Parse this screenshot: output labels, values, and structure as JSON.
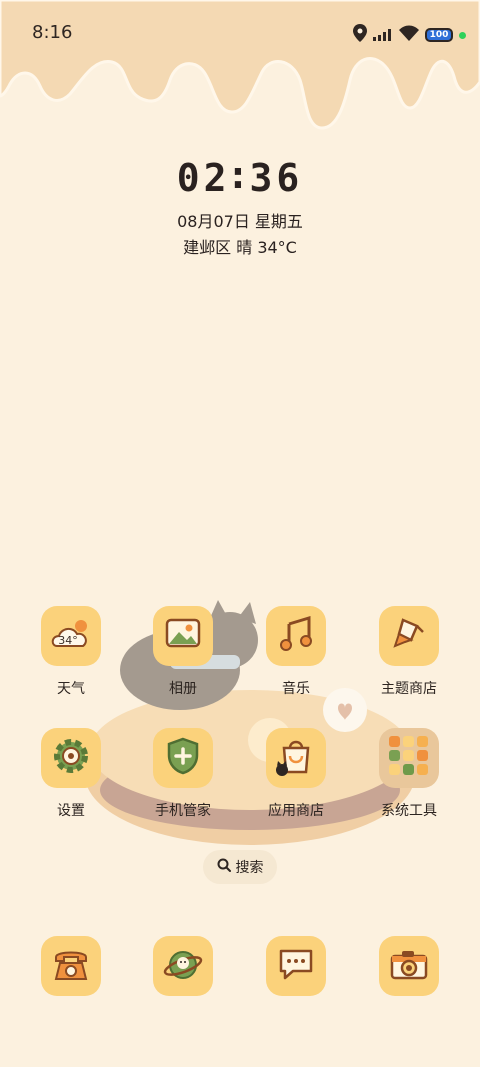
{
  "status_bar": {
    "time": "8:16",
    "battery": "100",
    "icons": [
      "location-icon",
      "signal-icon",
      "wifi-icon",
      "battery-icon",
      "privacy-dot"
    ]
  },
  "clock_widget": {
    "hour": "02",
    "minute": "36",
    "date": "08月07日 星期五",
    "weather": "建邺区 晴 34°C"
  },
  "apps_row1": [
    {
      "label": "天气",
      "icon": "weather-icon",
      "badge": "34°"
    },
    {
      "label": "相册",
      "icon": "gallery-icon"
    },
    {
      "label": "音乐",
      "icon": "music-icon"
    },
    {
      "label": "主题商店",
      "icon": "theme-store-icon"
    }
  ],
  "apps_row2": [
    {
      "label": "设置",
      "icon": "settings-icon"
    },
    {
      "label": "手机管家",
      "icon": "phone-manager-icon"
    },
    {
      "label": "应用商店",
      "icon": "app-store-icon"
    },
    {
      "label": "系统工具",
      "icon": "system-tools-folder-icon"
    }
  ],
  "search": {
    "label": "搜索"
  },
  "dock": [
    {
      "icon": "phone-icon"
    },
    {
      "icon": "browser-icon"
    },
    {
      "icon": "messages-icon"
    },
    {
      "icon": "camera-icon"
    }
  ],
  "colors": {
    "background": "#fcf1df",
    "drip": "#f4d9b3",
    "icon_bg": "#fbd27b",
    "icon_stroke": "#8a4a22",
    "accent_orange": "#f0913e",
    "accent_green": "#6f9a4a"
  }
}
